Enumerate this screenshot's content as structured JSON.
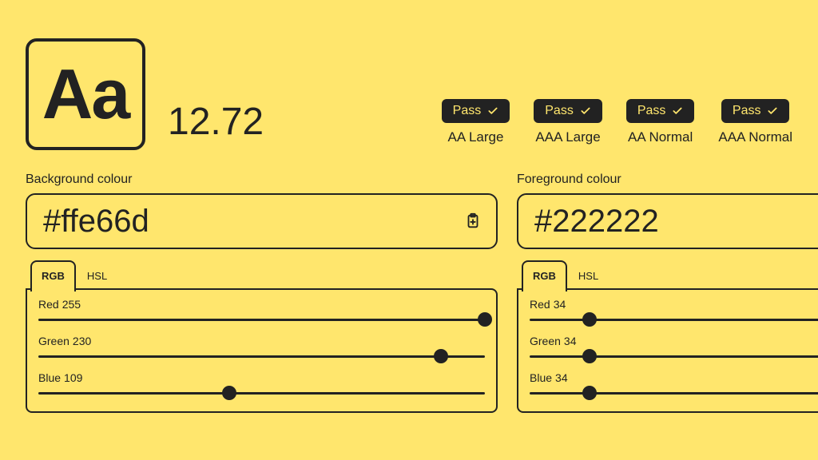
{
  "sample_text": "Aa",
  "contrast_ratio": "12.72",
  "compliance": [
    {
      "status": "Pass",
      "label": "AA Large"
    },
    {
      "status": "Pass",
      "label": "AAA Large"
    },
    {
      "status": "Pass",
      "label": "AA Normal"
    },
    {
      "status": "Pass",
      "label": "AAA Normal"
    }
  ],
  "background": {
    "title": "Background colour",
    "hex": "#ffe66d",
    "tabs": {
      "active": "RGB",
      "inactive": "HSL"
    },
    "channels": [
      {
        "label": "Red",
        "value": "255",
        "max": 255
      },
      {
        "label": "Green",
        "value": "230",
        "max": 255
      },
      {
        "label": "Blue",
        "value": "109",
        "max": 255
      }
    ]
  },
  "foreground": {
    "title": "Foreground colour",
    "hex": "#222222",
    "tabs": {
      "active": "RGB",
      "inactive": "HSL"
    },
    "channels": [
      {
        "label": "Red",
        "value": "34",
        "max": 255
      },
      {
        "label": "Green",
        "value": "34",
        "max": 255
      },
      {
        "label": "Blue",
        "value": "34",
        "max": 255
      }
    ]
  }
}
